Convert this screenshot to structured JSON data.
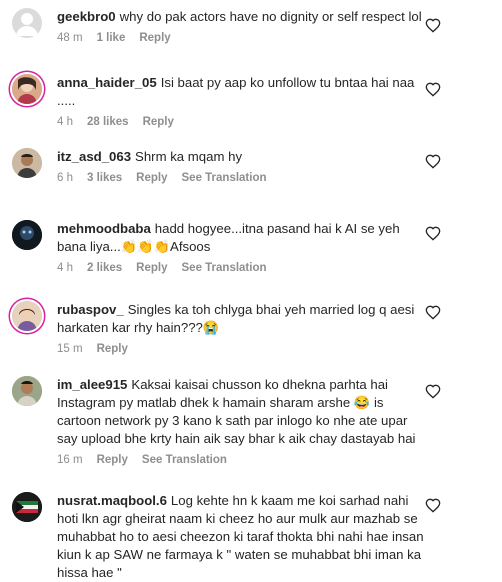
{
  "comments": [
    {
      "username": "geekbro0",
      "text": "why do pak actors have no dignity or self respect lol",
      "time": "48 m",
      "likes": "1 like",
      "reply": "Reply",
      "see_translation": ""
    },
    {
      "username": "anna_haider_05",
      "text": "Isi baat py aap ko unfollow tu bntaa hai naa .....",
      "time": "4 h",
      "likes": "28 likes",
      "reply": "Reply",
      "see_translation": ""
    },
    {
      "username": "itz_asd_063",
      "text": "Shrm ka mqam hy",
      "time": "6 h",
      "likes": "3 likes",
      "reply": "Reply",
      "see_translation": "See Translation"
    },
    {
      "username": "mehmoodbaba",
      "text": "hadd hogyee...itna pasand hai k AI se yeh bana liya...👏👏👏Afsoos",
      "time": "4 h",
      "likes": "2 likes",
      "reply": "Reply",
      "see_translation": "See Translation"
    },
    {
      "username": "rubaspov_",
      "text": "Singles ka toh chlyga bhai yeh married log q aesi harkaten kar rhy hain???😭",
      "time": "15 m",
      "likes": "",
      "reply": "Reply",
      "see_translation": ""
    },
    {
      "username": "im_alee915",
      "text": "Kaksai kaisai chusson ko dhekna parhta hai Instagram py matlab dhek k hamain sharam arshe 😂 is cartoon network py 3 kano k sath par inlogo ko nhe ate upar say upload bhe krty hain aik say bhar k aik chay dastayab hai",
      "time": "16 m",
      "likes": "",
      "reply": "Reply",
      "see_translation": "See Translation"
    },
    {
      "username": "nusrat.maqbool.6",
      "text": "Log kehte hn k kaam me koi sarhad nahi hoti lkn agr gheirat naam ki cheez ho aur mulk aur mazhab se muhabbat ho to aesi cheezon ki taraf thokta bhi nahi hae insan kiun k ap SAW ne farmaya k \" waten se muhabbat bhi iman ka hissa hae \"",
      "time": "",
      "likes": "",
      "reply": "",
      "see_translation": ""
    }
  ],
  "colors": {
    "text": "#262626",
    "meta": "#8e8e8e",
    "heart": "#262626"
  },
  "icons": {
    "like": "heart-outline-icon"
  }
}
